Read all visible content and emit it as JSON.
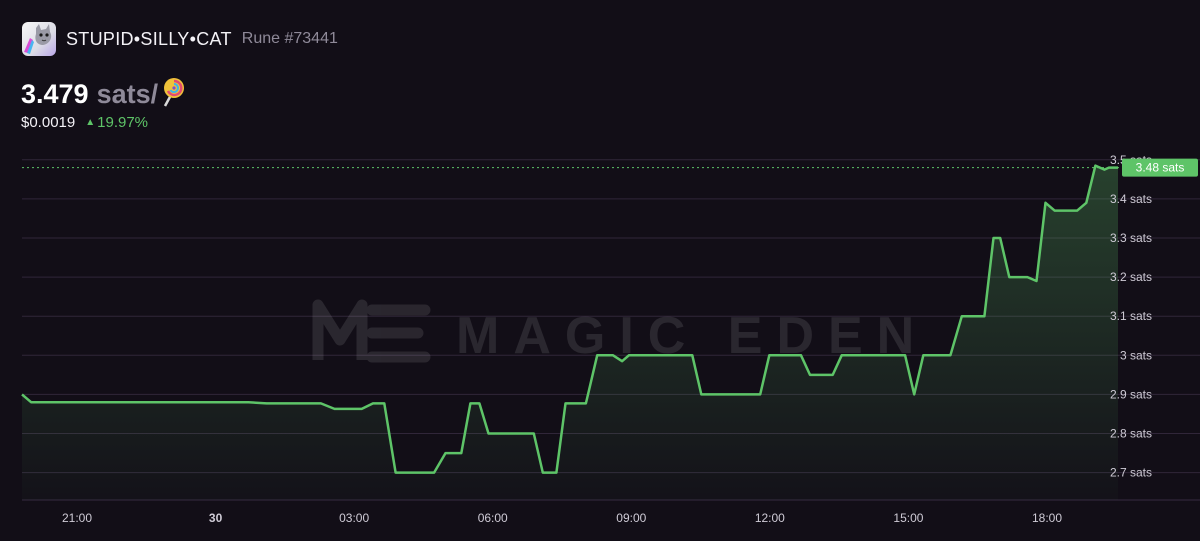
{
  "header": {
    "token_name": "STUPID•SILLY•CAT",
    "rune_id": "Rune #73441",
    "icon": "cat-token-icon"
  },
  "price": {
    "value": "3.479",
    "unit": "sats/",
    "unit_icon": "lollipop-icon",
    "usd": "$0.0019",
    "change": "19.97%",
    "change_direction": "up"
  },
  "watermark": "MAGIC EDEN",
  "colors": {
    "background": "#120e17",
    "line": "#5ec468",
    "positive": "#5ec468",
    "grid": "#3a2f45",
    "muted_text": "#8f8a99"
  },
  "chart_data": {
    "type": "line",
    "ylim": [
      2.63,
      3.525
    ],
    "xlim": [
      0,
      22.3
    ],
    "y_ticks": [
      {
        "value": 3.5,
        "label": "3.5 sats"
      },
      {
        "value": 3.4,
        "label": "3.4 sats"
      },
      {
        "value": 3.3,
        "label": "3.3 sats"
      },
      {
        "value": 3.2,
        "label": "3.2 sats"
      },
      {
        "value": 3.1,
        "label": "3.1 sats"
      },
      {
        "value": 3.0,
        "label": "3 sats"
      },
      {
        "value": 2.9,
        "label": "2.9 sats"
      },
      {
        "value": 2.8,
        "label": "2.8 sats"
      },
      {
        "value": 2.7,
        "label": "2.7 sats"
      }
    ],
    "x_ticks": [
      {
        "value": 1.0,
        "label": "21:00",
        "bold": false
      },
      {
        "value": 4.0,
        "label": "30",
        "bold": true
      },
      {
        "value": 7.0,
        "label": "03:00",
        "bold": false
      },
      {
        "value": 10.0,
        "label": "06:00",
        "bold": false
      },
      {
        "value": 13.0,
        "label": "09:00",
        "bold": false
      },
      {
        "value": 16.0,
        "label": "12:00",
        "bold": false
      },
      {
        "value": 19.0,
        "label": "15:00",
        "bold": false
      },
      {
        "value": 22.0,
        "label": "18:00",
        "bold": false
      }
    ],
    "current_price": {
      "value": 3.48,
      "label": "3.48 sats"
    },
    "grid": true,
    "series": [
      {
        "points": [
          [
            0.0,
            2.9
          ],
          [
            0.2,
            2.88
          ],
          [
            2.0,
            2.88
          ],
          [
            4.0,
            2.88
          ],
          [
            5.0,
            2.88
          ],
          [
            5.4,
            2.877
          ],
          [
            6.6,
            2.877
          ],
          [
            6.9,
            2.863
          ],
          [
            7.5,
            2.863
          ],
          [
            7.75,
            2.877
          ],
          [
            8.0,
            2.877
          ],
          [
            8.25,
            2.7
          ],
          [
            9.1,
            2.7
          ],
          [
            9.35,
            2.75
          ],
          [
            9.7,
            2.75
          ],
          [
            9.9,
            2.877
          ],
          [
            10.1,
            2.877
          ],
          [
            10.3,
            2.8
          ],
          [
            11.3,
            2.8
          ],
          [
            11.5,
            2.7
          ],
          [
            11.8,
            2.7
          ],
          [
            12.0,
            2.877
          ],
          [
            12.45,
            2.877
          ],
          [
            12.7,
            3.0
          ],
          [
            13.05,
            3.0
          ],
          [
            13.25,
            2.985
          ],
          [
            13.4,
            3.0
          ],
          [
            14.8,
            3.0
          ],
          [
            15.0,
            2.9
          ],
          [
            16.3,
            2.9
          ],
          [
            16.5,
            3.0
          ],
          [
            17.2,
            3.0
          ],
          [
            17.4,
            2.95
          ],
          [
            17.9,
            2.95
          ],
          [
            18.1,
            3.0
          ],
          [
            19.5,
            3.0
          ],
          [
            19.7,
            2.9
          ],
          [
            19.9,
            3.0
          ],
          [
            20.5,
            3.0
          ],
          [
            20.75,
            3.1
          ],
          [
            21.25,
            3.1
          ],
          [
            21.45,
            3.3
          ],
          [
            21.6,
            3.3
          ],
          [
            21.8,
            3.2
          ],
          [
            22.2,
            3.2
          ],
          [
            22.4,
            3.19
          ],
          [
            22.6,
            3.39
          ],
          [
            22.8,
            3.37
          ],
          [
            23.3,
            3.37
          ],
          [
            23.5,
            3.39
          ],
          [
            23.7,
            3.485
          ],
          [
            23.9,
            3.475
          ],
          [
            24.0,
            3.48
          ],
          [
            24.2,
            3.48
          ]
        ]
      }
    ]
  }
}
